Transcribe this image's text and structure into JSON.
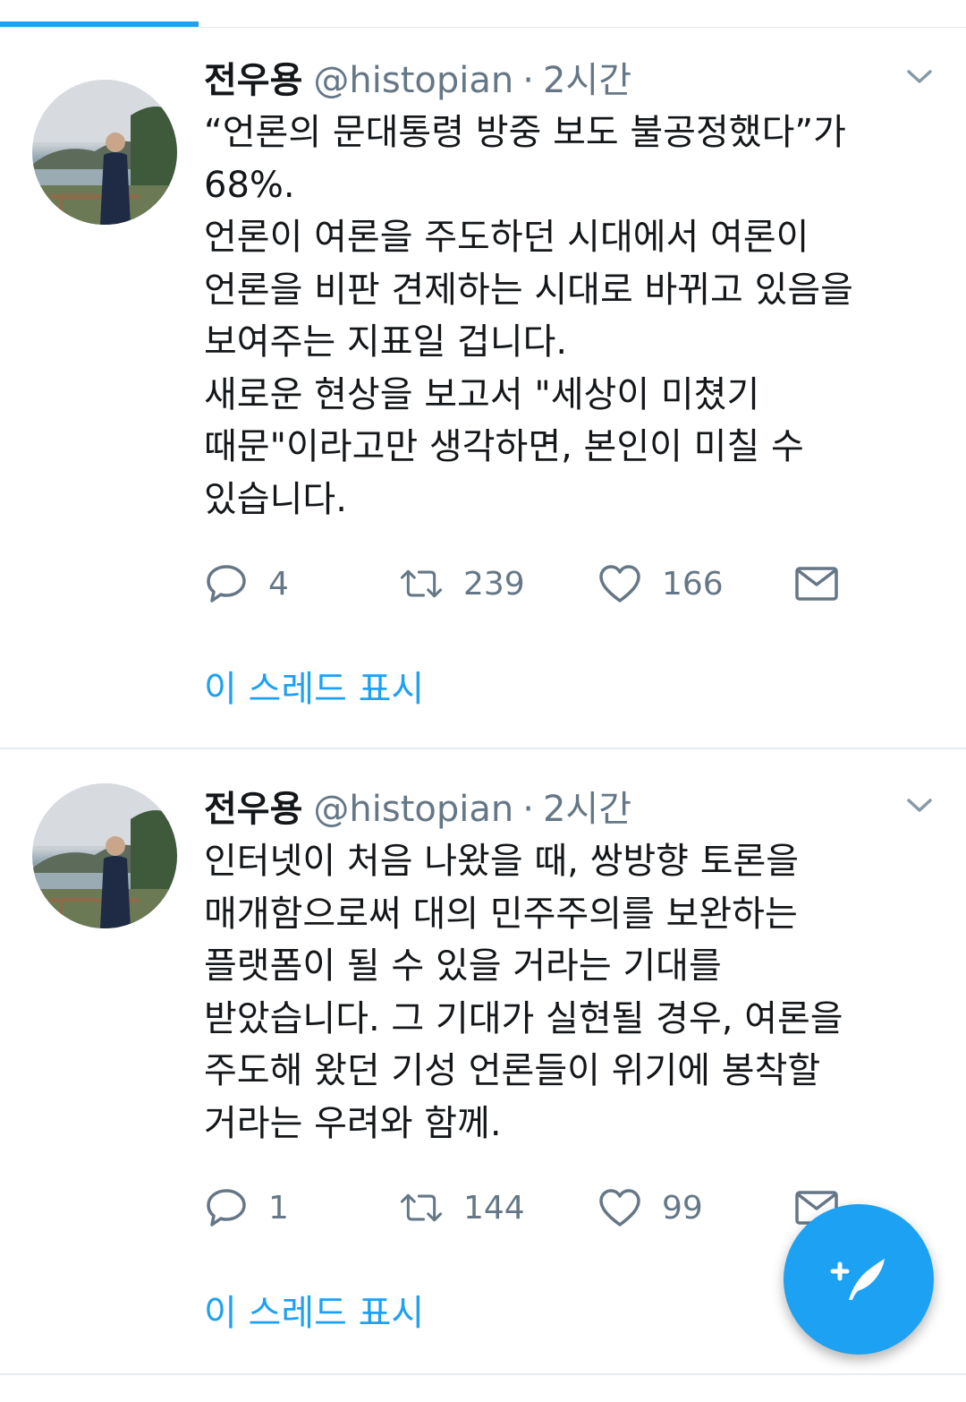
{
  "tweets": [
    {
      "display_name": "전우용",
      "handle": "@histopian",
      "time_separator": "·",
      "time": "2시간",
      "text": "“언론의 문대통령 방중 보도 불공정했다”가\n68%.\n언론이 여론을 주도하던 시대에서 여론이\n언론을 비판 견제하는 시대로 바뀌고 있음을\n보여주는 지표일 겁니다.\n새로운 현상을 보고서 \"세상이 미쳤기\n때문\"이라고만 생각하면, 본인이 미칠 수\n있습니다.",
      "reply_count": "4",
      "retweet_count": "239",
      "like_count": "166",
      "thread_label": "이 스레드 표시"
    },
    {
      "display_name": "전우용",
      "handle": "@histopian",
      "time_separator": "·",
      "time": "2시간",
      "text": "인터넷이 처음 나왔을 때, 쌍방향 토론을\n매개함으로써 대의 민주주의를 보완하는\n플랫폼이 될 수 있을 거라는 기대를\n받았습니다. 그 기대가 실현될 경우, 여론을\n주도해 왔던 기성 언론들이 위기에 봉착할\n거라는 우려와 함께.",
      "reply_count": "1",
      "retweet_count": "144",
      "like_count": "99",
      "thread_label": "이 스레드 표시"
    }
  ],
  "icons": {
    "reply": "reply-icon",
    "retweet": "retweet-icon",
    "like": "heart-icon",
    "direct_message": "mail-icon",
    "more": "chevron-down-icon",
    "compose": "compose-tweet-icon"
  },
  "colors": {
    "accent": "#1da1f2",
    "secondary_text": "#657786",
    "primary_text": "#14171a",
    "divider": "#e6ecf0"
  }
}
